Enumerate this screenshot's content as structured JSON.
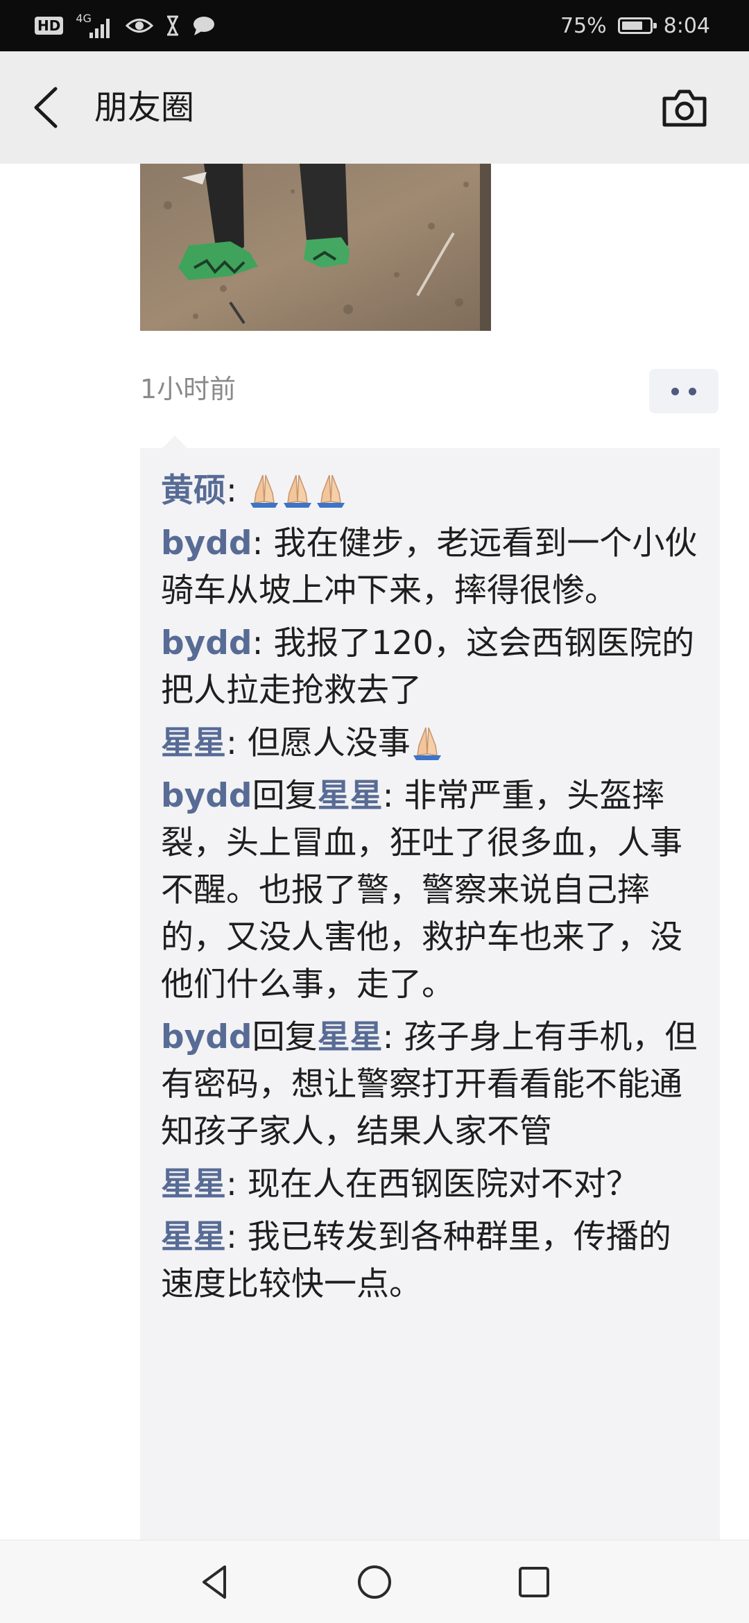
{
  "status_bar": {
    "hd": "HD",
    "network": "4G",
    "battery": "75%",
    "battery_level": 0.75,
    "time": "8:04",
    "icons": [
      "hd-icon",
      "signal-icon",
      "eye-icon",
      "hourglass-icon",
      "chat-icon",
      "battery-icon"
    ]
  },
  "nav": {
    "title": "朋友圈",
    "back_icon": "back-arrow-icon",
    "camera_icon": "camera-icon"
  },
  "post": {
    "time": "1小时前",
    "more_icon": "more-dots-icon"
  },
  "comments": [
    {
      "user": "黄硕",
      "reply_to": "",
      "text": "",
      "emoji": 3
    },
    {
      "user": "bydd",
      "reply_to": "",
      "text": "我在健步，老远看到一个小伙骑车从坡上冲下来，摔得很惨。",
      "emoji": 0
    },
    {
      "user": "bydd",
      "reply_to": "",
      "text": "我报了120，这会西钢医院的把人拉走抢救去了",
      "emoji": 0
    },
    {
      "user": "星星",
      "reply_to": "",
      "text": "但愿人没事",
      "emoji": 1
    },
    {
      "user": "bydd",
      "reply_to": "星星",
      "text": "非常严重，头盔摔裂，头上冒血，狂吐了很多血，人事不醒。也报了警，警察来说自己摔的，又没人害他，救护车也来了，没他们什么事，走了。",
      "emoji": 0
    },
    {
      "user": "bydd",
      "reply_to": "星星",
      "text": "孩子身上有手机，但有密码，想让警察打开看看能不能通知孩子家人，结果人家不管",
      "emoji": 0
    },
    {
      "user": "星星",
      "reply_to": "",
      "text": "现在人在西钢医院对不对？",
      "emoji": 0
    },
    {
      "user": "星星",
      "reply_to": "",
      "text": "我已转发到各种群里，传播的速度比较快一点。",
      "emoji": 0
    }
  ],
  "labels": {
    "separator": ": ",
    "reply_word": "回复"
  },
  "system_nav": {
    "icons": [
      "back-triangle-icon",
      "home-circle-icon",
      "recents-square-icon"
    ]
  }
}
